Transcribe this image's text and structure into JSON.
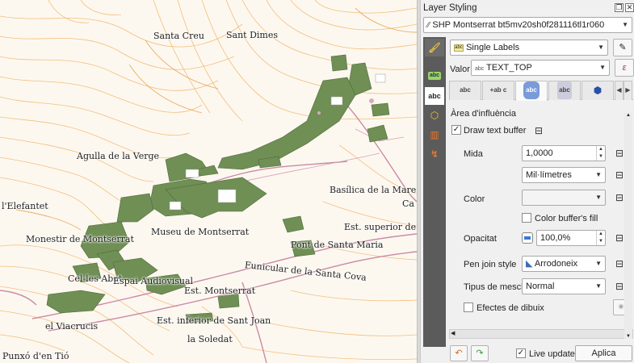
{
  "panel": {
    "title": "Layer Styling",
    "layer_name": "SHP Montserrat bt5mv20sh0f281116tl1r060",
    "renderer": "Single Labels",
    "value_label": "Valor",
    "value_field": "TEXT_TOP",
    "section_title": "Àrea d'influència",
    "draw_buffer_label": "Draw text buffer",
    "draw_buffer_checked": true,
    "size_label": "Mida",
    "size_value": "1,0000",
    "unit_value": "Mil·límetres",
    "color_label": "Color",
    "fill_buffer_label": "Color buffer's fill",
    "opacity_label": "Opacitat",
    "opacity_value": "100,0%",
    "join_style_label": "Pen join style",
    "join_style_value": "Arrodoneix",
    "blend_label": "Tipus de mescla",
    "blend_value": "Normal",
    "effects_label": "Efectes de dibuix",
    "live_update_label": "Live update",
    "live_update_checked": true,
    "apply_label": "Aplica",
    "tabs": [
      "abc",
      "+ab c",
      "abc",
      "abc"
    ]
  },
  "map_labels": [
    "Santa Creu",
    "Sant Dimes",
    "Agulla de la Verge",
    "l'Elefantet",
    "Monestir de Montserrat",
    "Museu de Montserrat",
    "Basílica de la Mare de",
    "Ca",
    "Est. superior de la",
    "Pont de Santa Maria",
    "Funicular de la Santa Cova",
    "Cel-les Abat",
    "Espai Audiovisual",
    "Est. Montserrat",
    "el Viacrucis",
    "Est. inferior de Sant Joan",
    "la Soledat",
    "Punxó d'en Tió"
  ],
  "colors": {
    "contour": "#f1b46a",
    "building": "#6f8f55",
    "road": "#c98aa8",
    "panel_bg": "#f0f0f0",
    "sidebar_bg": "#5b5b5b"
  }
}
